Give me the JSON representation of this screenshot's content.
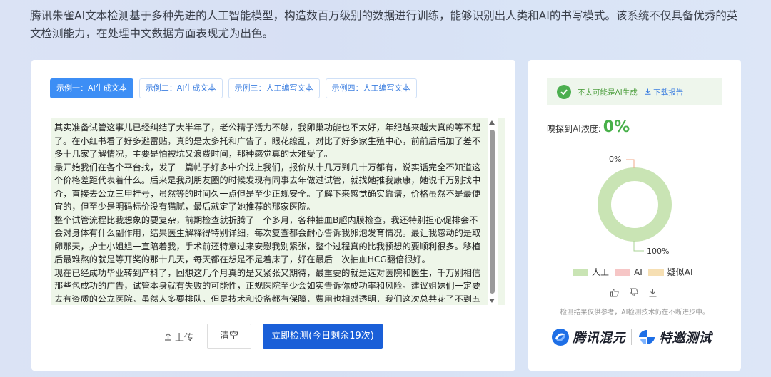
{
  "intro": {
    "text": "腾讯朱雀AI文本检测基于多种先进的人工智能模型，构造数百万级别的数据进行训练，能够识别出人类和AI的书写模式。该系统不仅具备优秀的英文检测能力，在处理中文数据方面表现尤为出色。"
  },
  "tabs": [
    {
      "label": "示例一：AI生成文本",
      "active": true
    },
    {
      "label": "示例二：AI生成文本",
      "active": false
    },
    {
      "label": "示例三：人工编写文本",
      "active": false
    },
    {
      "label": "示例四：人工编写文本",
      "active": false
    }
  ],
  "input": {
    "paragraphs": [
      "其实准备试管这事儿已经纠结了大半年了，老公精子活力不够，我卵巢功能也不太好，年纪越来越大真的等不起了。在小红书看了好多避雷贴，真的是太多托和广告了，眼花缭乱，对比了好多家生殖中心，前前后后加了差不多十几家了解情况，主要是怕被坑又浪费时间，那种感觉真的太难受了。",
      "最开始我们在各个平台找，发了一篇帖子好多中介找上我们，报价从十几万到几十万都有，说实话完全不知道这个价格差距代表着什么。后来是我刷朋友圈的时候发现有同事去年做过试管，就找她推我康康，她说千万别找中介，直接去公立三甲挂号，虽然等的时间久一点但是至少正规安全。了解下来感觉确实靠谱，价格虽然不是最便宜的，但至少是明码标价没有猫腻，最后就定了她推荐的那家医院。",
      "整个试管流程比我想象的要复杂，前期检查就折腾了一个多月，各种抽血B超内膜检查，我还特别担心促排会不会对身体有什么副作用，结果医生解释得特别详细，每次复查都会耐心告诉我卵泡发育情况。最让我感动的是取卵那天，护士小姐姐一直陪着我，手术前还特意过来安慰我别紧张，整个过程真的比我预想的要顺利很多。移植后最难熬的就是等开奖的那十几天，每天都在想是不是着床了，好在最后一次抽血HCG翻倍很好。",
      "现在已经成功毕业转到产科了，回想这几个月真的是又紧张又期待，最重要的就是选对医院和医生，千万别相信那些包成功的广告，试管本身就有失败的可能性，正规医院至少会如实告诉你成功率和风险。建议姐妹们一定要去有资质的公立医院，虽然人多要排队，但是技术和设备都有保障，费用也相对透明，我们这次总共花了不到五"
    ]
  },
  "actions": {
    "upload_label": "上传",
    "clear_label": "清空",
    "detect_label": "立即检测(今日剩余19次)"
  },
  "result": {
    "verdict": "不太可能是AI生成",
    "report_label": "下载报告",
    "ai_level_label": "嗅探到AI浓度:",
    "ai_level_value": "0%",
    "donut_top_label": "0%",
    "donut_bottom_label": "100%",
    "legend": [
      {
        "label": "人工",
        "color": "#c9e4b4"
      },
      {
        "label": "AI",
        "color": "#f6c6c6"
      },
      {
        "label": "疑似AI",
        "color": "#f6dfb3"
      }
    ],
    "note": "检测结果仅供参考，AI检测技术仍在不断进步中。"
  },
  "chart_data": {
    "type": "pie",
    "categories": [
      "人工",
      "AI",
      "疑似AI"
    ],
    "values": [
      100,
      0,
      0
    ],
    "colors": [
      "#c9e4b4",
      "#f6c6c6",
      "#f6dfb3"
    ]
  },
  "logos": {
    "left": "腾讯混元",
    "right": "特邀测试"
  }
}
